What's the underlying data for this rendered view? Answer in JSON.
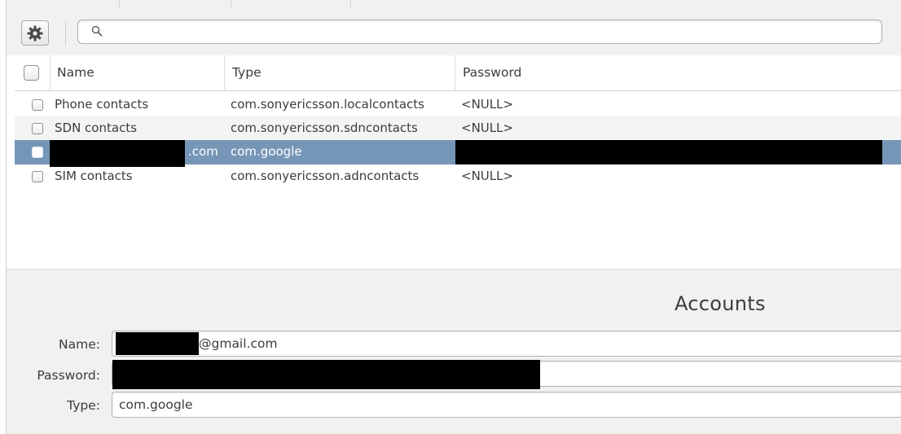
{
  "toolbar": {
    "settings_icon": "gear-icon",
    "search_icon": "search-icon",
    "search_value": ""
  },
  "table": {
    "columns": [
      "Name",
      "Type",
      "Password"
    ],
    "rows": [
      {
        "name": "Phone contacts",
        "type": "com.sonyericsson.localcontacts",
        "password": "<NULL>"
      },
      {
        "name": "SDN contacts",
        "type": "com.sonyericsson.sdncontacts",
        "password": "<NULL>"
      },
      {
        "name": ".com",
        "type": "com.google",
        "password": "",
        "selected": true
      },
      {
        "name": "SIM contacts",
        "type": "com.sonyericsson.adncontacts",
        "password": "<NULL>"
      }
    ]
  },
  "details": {
    "title": "Accounts",
    "name_label": "Name:",
    "name_value": "@gmail.com",
    "password_label": "Password:",
    "password_value": "",
    "type_label": "Type:",
    "type_value": "com.google"
  },
  "colors": {
    "selection": "#7696b7",
    "panel": "#f2f1f0",
    "redaction": "#000000"
  }
}
